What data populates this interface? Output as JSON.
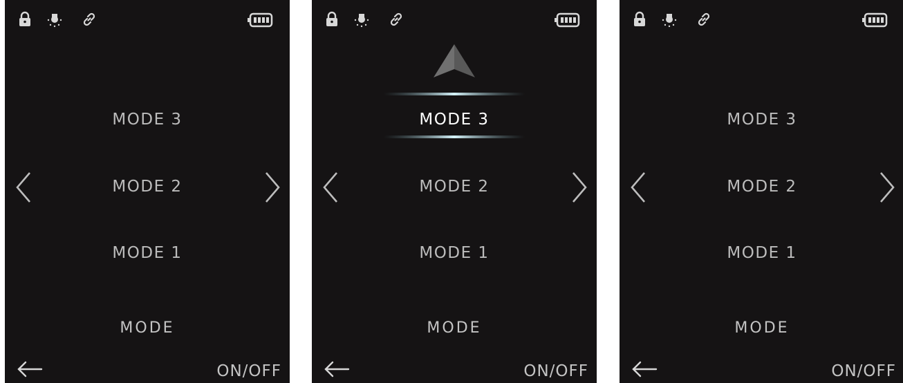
{
  "screens": [
    {
      "state": "idle",
      "modes": [
        "MODE 3",
        "MODE 2",
        "MODE 1"
      ],
      "selected_mode": null,
      "mode_label": "MODE",
      "power_label": "ON/OFF",
      "status_icons": [
        "lock-icon",
        "light-bulb-icon",
        "link-icon",
        "battery-icon"
      ]
    },
    {
      "state": "mode-3-selected",
      "modes": [
        "MODE 3",
        "MODE 2",
        "MODE 1"
      ],
      "selected_mode": "MODE 3",
      "mode_label": "MODE",
      "power_label": "ON/OFF",
      "status_icons": [
        "lock-icon",
        "light-bulb-icon",
        "link-icon",
        "battery-icon"
      ]
    },
    {
      "state": "idle",
      "modes": [
        "MODE 3",
        "MODE 2",
        "MODE 1"
      ],
      "selected_mode": null,
      "mode_label": "MODE",
      "power_label": "ON/OFF",
      "status_icons": [
        "lock-icon",
        "light-bulb-icon",
        "link-icon",
        "battery-icon"
      ]
    }
  ],
  "colors": {
    "screen_background": "#151314",
    "text": "#bcbcbc",
    "selected_text": "#ffffff",
    "highlight_glow": "#bfe9f2"
  }
}
